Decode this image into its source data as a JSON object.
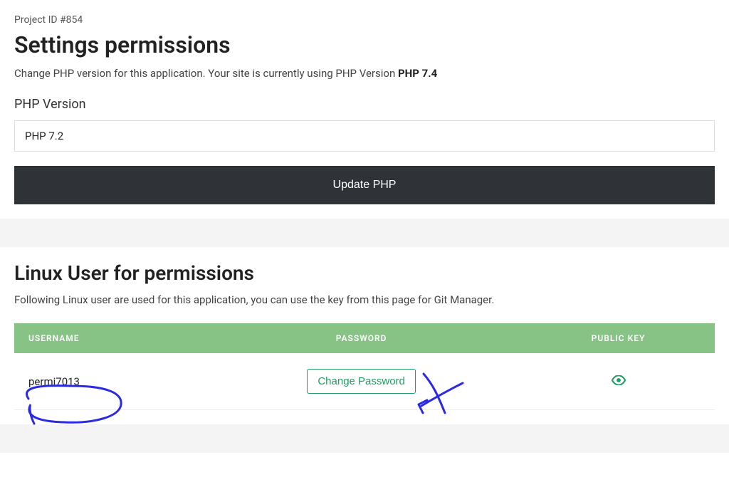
{
  "project_id_label": "Project ID #854",
  "page_title": "Settings permissions",
  "php_desc_prefix": "Change PHP version for this application. Your site is currently using PHP Version ",
  "php_current_version": "PHP 7.4",
  "php_version_label": "PHP Version",
  "php_selected": "PHP 7.2",
  "update_php_label": "Update PHP",
  "linux_title": "Linux User for permissions",
  "linux_desc": "Following Linux user are used for this application, you can use the key from this page for Git Manager.",
  "table": {
    "headers": {
      "username": "Username",
      "password": "Password",
      "public_key": "Public Key"
    },
    "row": {
      "username": "permi7013",
      "change_password_label": "Change Password"
    }
  }
}
